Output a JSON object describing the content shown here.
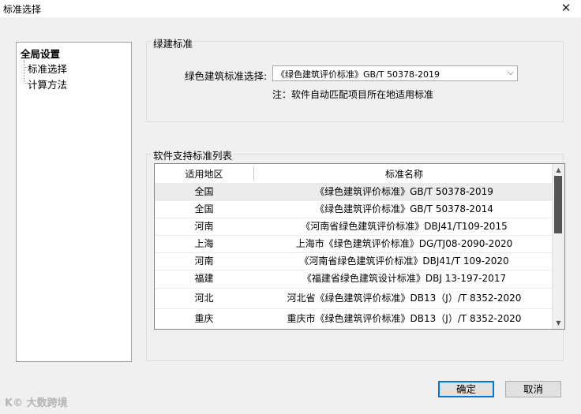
{
  "window": {
    "title": "标准选择",
    "close_glyph": "✕"
  },
  "tree": {
    "root": "全局设置",
    "children": [
      "标准选择",
      "计算方法"
    ]
  },
  "green_std_group": {
    "title": "绿建标准",
    "select_label": "绿色建筑标准选择:",
    "selected_value": "《绿色建筑评价标准》GB/T 50378-2019",
    "note": "注：软件自动匹配项目所在地适用标准"
  },
  "list_group": {
    "title": "软件支持标准列表",
    "columns": [
      "适用地区",
      "标准名称"
    ],
    "rows": [
      {
        "region": "全国",
        "name": "《绿色建筑评价标准》GB/T 50378-2019"
      },
      {
        "region": "全国",
        "name": "《绿色建筑评价标准》GB/T 50378-2014"
      },
      {
        "region": "河南",
        "name": "《河南省绿色建筑评价标准》DBJ41/T109-2015"
      },
      {
        "region": "上海",
        "name": "上海市《绿色建筑评价标准》DG/TJ08-2090-2020"
      },
      {
        "region": "河南",
        "name": "《河南省绿色建筑评价标准》DBJ41/T 109-2020"
      },
      {
        "region": "福建",
        "name": "《福建省绿色建筑设计标准》DBJ 13-197-2017"
      },
      {
        "region": "河北",
        "name": "河北省《绿色建筑评价标准》DB13（J）/T 8352-2020"
      },
      {
        "region": "重庆",
        "name": "重庆市《绿色建筑评价标准》DB13（J）/T 8352-2020"
      }
    ],
    "selected_row": 0
  },
  "buttons": {
    "ok": "确定",
    "cancel": "取消"
  },
  "watermark": "K© 大数跨境",
  "colors": {
    "default_button_border": "#0078d7",
    "selected_row": "#ececec"
  }
}
